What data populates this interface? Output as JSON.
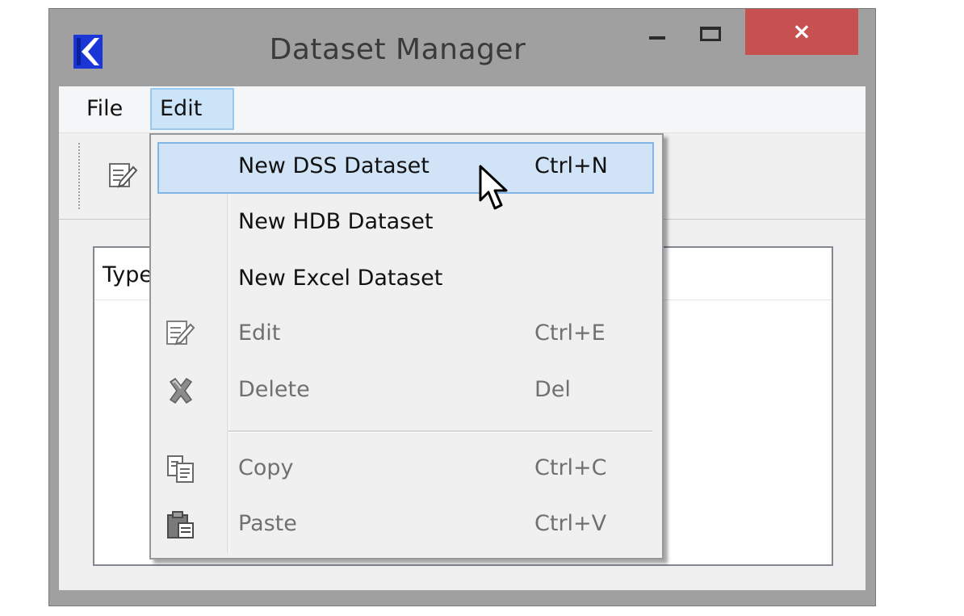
{
  "window": {
    "title": "Dataset Manager",
    "app_icon": "riverware-logo-icon",
    "controls": {
      "minimize": "minimize-icon",
      "maximize": "maximize-icon",
      "close": "×"
    },
    "close_color": "#c75050"
  },
  "menubar": {
    "items": [
      {
        "label": "File"
      },
      {
        "label": "Edit",
        "state": "open"
      }
    ]
  },
  "toolbar": {
    "edit_icon": "edit-icon"
  },
  "tree": {
    "header": "Type"
  },
  "edit_menu": {
    "items": [
      {
        "label": "New DSS Dataset",
        "shortcut": "Ctrl+N",
        "enabled": true,
        "highlighted": true
      },
      {
        "label": "New HDB Dataset",
        "shortcut": "",
        "enabled": true
      },
      {
        "label": "New Excel Dataset",
        "shortcut": "",
        "enabled": true
      },
      {
        "label": "Edit",
        "shortcut": "Ctrl+E",
        "enabled": false,
        "icon": "edit-icon"
      },
      {
        "label": "Delete",
        "shortcut": "Del",
        "enabled": false,
        "icon": "delete-icon"
      },
      {
        "label": "Copy",
        "shortcut": "Ctrl+C",
        "enabled": false,
        "icon": "copy-icon"
      },
      {
        "label": "Paste",
        "shortcut": "Ctrl+V",
        "enabled": false,
        "icon": "paste-icon"
      }
    ],
    "highlight_color": "#d1e4f7"
  }
}
